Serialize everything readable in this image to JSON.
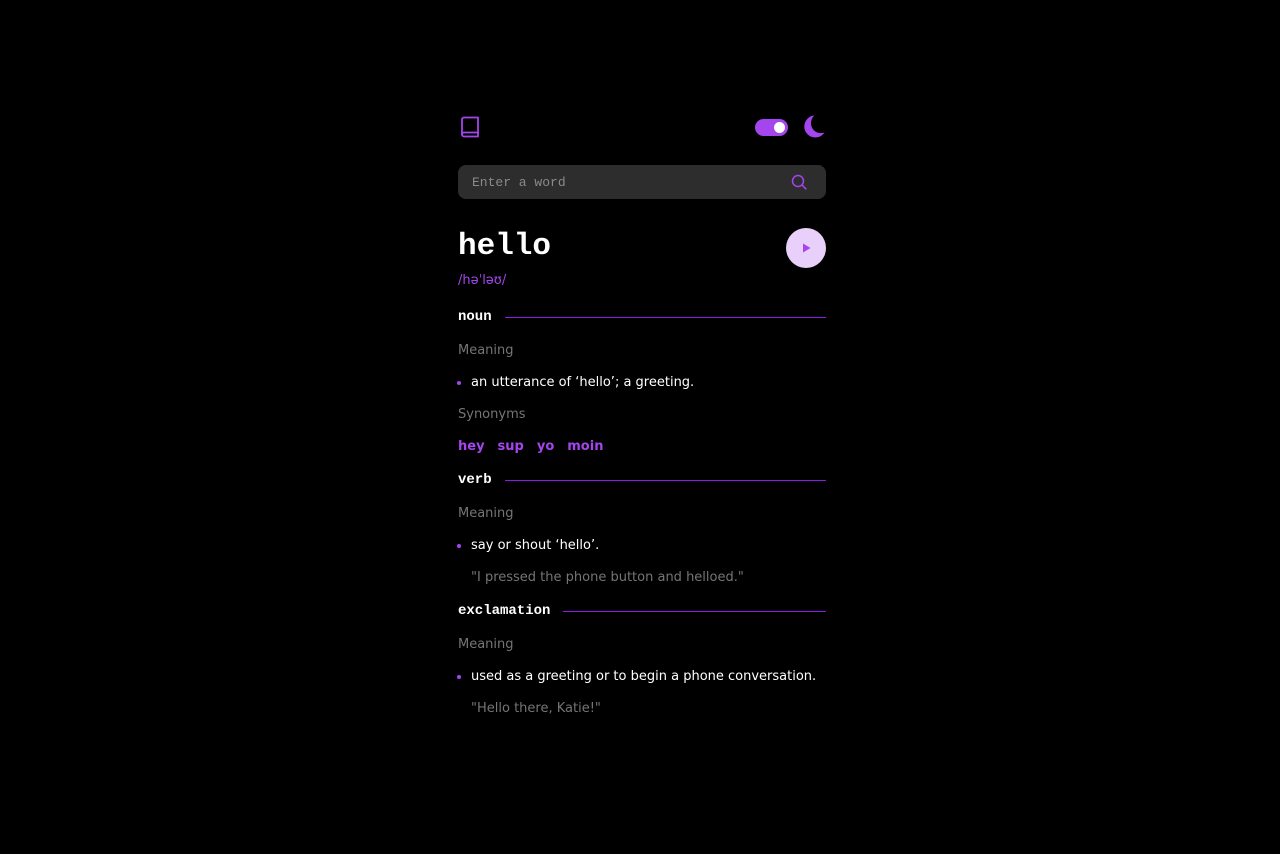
{
  "header": {
    "logo_icon": "book-icon",
    "theme_toggle_icon": "toggle-icon",
    "theme_icon": "moon-icon"
  },
  "search": {
    "placeholder": "Enter a word",
    "value": "",
    "icon": "search-icon"
  },
  "word": {
    "text": "hello",
    "phonetic": "/həˈləʊ/",
    "play_icon": "play-icon"
  },
  "meanings": {
    "noun": {
      "part_of_speech": "noun",
      "meaning_label": "Meaning",
      "definition": "an utterance of ‘hello’; a greeting.",
      "synonyms_label": "Synonyms",
      "synonyms": [
        "hey",
        "sup",
        "yo",
        "moin"
      ]
    },
    "verb": {
      "part_of_speech": "verb",
      "meaning_label": "Meaning",
      "definition": "say or shout ‘hello’.",
      "example": "\"I pressed the phone button and helloed.\""
    },
    "exclamation": {
      "part_of_speech": "exclamation",
      "meaning_label": "Meaning",
      "definition": "used as a greeting or to begin a phone conversation.",
      "example": "\"Hello there, Katie!\""
    }
  },
  "colors": {
    "accent": "#a445ed",
    "background": "#000000",
    "input_bg": "#2d2d2d",
    "muted": "#757575",
    "play_bg": "#e9d0fa"
  }
}
